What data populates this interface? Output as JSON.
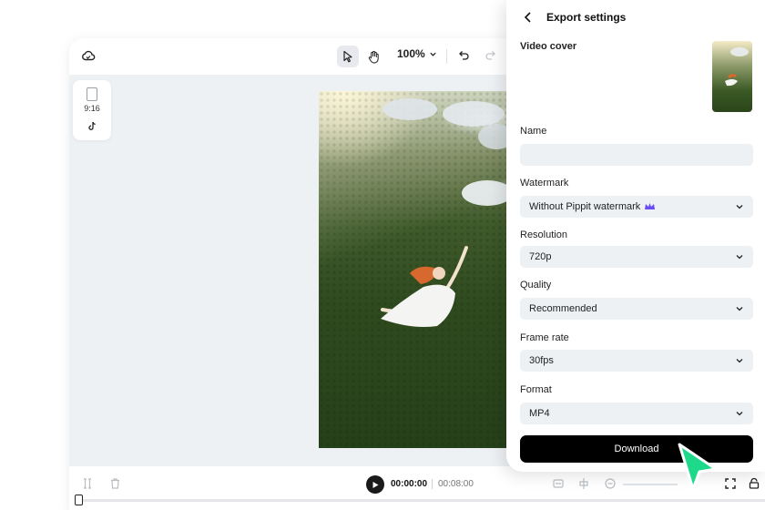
{
  "toolbar": {
    "zoom_value": "100%"
  },
  "canvas": {
    "aspect_ratio_label": "9:16"
  },
  "export_panel": {
    "title": "Export settings",
    "video_cover_label": "Video cover",
    "name_label": "Name",
    "name_value": "",
    "watermark_label": "Watermark",
    "watermark_value": "Without Pippit watermark",
    "resolution_label": "Resolution",
    "resolution_value": "720p",
    "quality_label": "Quality",
    "quality_value": "Recommended",
    "frame_rate_label": "Frame rate",
    "frame_rate_value": "30fps",
    "format_label": "Format",
    "format_value": "MP4",
    "download_label": "Download"
  },
  "playback": {
    "current_time": "00:00:00",
    "total_time": "00:08:00"
  },
  "colors": {
    "accent_cursor": "#1ed98a",
    "primary_button": "#000000",
    "field_background": "#eef1f4",
    "canvas_background": "#eef1f4",
    "premium_crown": "#6a4cf5"
  }
}
